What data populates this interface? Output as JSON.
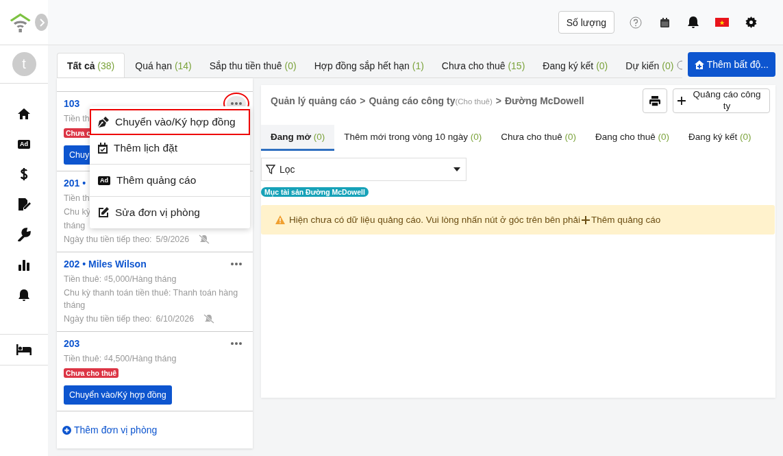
{
  "sidebar": {
    "avatar": "t",
    "items": [
      {
        "kind": "home"
      },
      {
        "kind": "ad",
        "text": "Ad"
      },
      {
        "kind": "dollar"
      },
      {
        "kind": "contract"
      },
      {
        "kind": "wrench"
      },
      {
        "kind": "chart"
      },
      {
        "kind": "bell"
      }
    ],
    "bottom_items": [
      {
        "kind": "bed"
      }
    ]
  },
  "topbar": {
    "quantity_button": "Số lượng",
    "icons": [
      {
        "kind": "help"
      },
      {
        "kind": "calendar"
      },
      {
        "kind": "bell"
      },
      {
        "kind": "flag"
      },
      {
        "kind": "settings"
      }
    ]
  },
  "tabs": [
    {
      "label": "Tất cả",
      "count": "(38)",
      "selected": true
    },
    {
      "label": "Quá hạn",
      "count": "(14)",
      "selected": false
    },
    {
      "label": "Sắp thu tiền thuê",
      "count": "(0)",
      "selected": false
    },
    {
      "label": "Hợp đồng sắp hết hạn",
      "count": "(1)",
      "selected": false
    },
    {
      "label": "Chưa cho thuê",
      "count": "(15)",
      "selected": false
    },
    {
      "label": "Đang ký kết",
      "count": "(0)",
      "selected": false
    },
    {
      "label": "Dự kiến",
      "count": "(0)",
      "selected": false
    }
  ],
  "add_property_button": "Thêm bất độ...",
  "units": [
    {
      "title": "103",
      "more": true,
      "more_highlighted": true,
      "lines": [
        "Tiền th"
      ],
      "badge": "Chưa c",
      "action": "Chuy"
    },
    {
      "title": "201 •",
      "lines": [
        "Tiền th",
        "Chu kỳ",
        "tháng"
      ],
      "next_label": "Ngày thu tiền tiếp theo:",
      "next_date": "5/9/2026"
    },
    {
      "title": "202 • Miles Wilson",
      "more": true,
      "lines": [
        "Tiền thuê: ₫5,000/Hàng tháng",
        "Chu kỳ thanh toán tiền thuê: Thanh toán hàng tháng"
      ],
      "next_label": "Ngày thu tiền tiếp theo:",
      "next_date": "6/10/2026"
    },
    {
      "title": "203",
      "more": true,
      "lines": [
        "Tiền thuê: ₫4,500/Hàng tháng"
      ],
      "badge": "Chưa cho thuê",
      "action": "Chuyển vào/Ký hợp đồng"
    }
  ],
  "add_unit": "Thêm đơn vị phòng",
  "menu": [
    {
      "kind": "pen",
      "label": "Chuyển vào/Ký hợp đồng",
      "selected": true
    },
    {
      "kind": "calendar",
      "label": "Thêm lịch đặt",
      "selected": false
    },
    {
      "kind": "ad",
      "label": "Thêm quảng cáo",
      "icon_text": "Ad",
      "selected": false
    },
    {
      "kind": "edit",
      "label": "Sửa đơn vị phòng",
      "selected": false
    }
  ],
  "panel": {
    "breadcrumb": [
      {
        "text": "Quản lý quảng cáo"
      },
      {
        "text": ">"
      },
      {
        "text": "Quảng cáo công ty",
        "note": "(Cho thuê)"
      },
      {
        "text": ">"
      },
      {
        "text": "Đường McDowell"
      }
    ],
    "add_ad_button": "Quảng cáo công ty",
    "tabs": [
      {
        "label": "Đang mở",
        "count": "(0)",
        "selected": true
      },
      {
        "label": "Thêm mới trong vòng 10 ngày",
        "count": "(0)",
        "selected": false
      },
      {
        "label": "Chưa cho thuê",
        "count": "(0)",
        "selected": false
      },
      {
        "label": "Đang cho thuê",
        "count": "(0)",
        "selected": false
      },
      {
        "label": "Đang ký kết",
        "count": "(0)",
        "selected": false
      }
    ],
    "filter": "Lọc",
    "tag": "Mục tài sản Đường McDowell",
    "alert": {
      "text": "Hiện chưa có dữ liệu quảng cáo. Vui lòng nhấn nút ở góc trên bên phải",
      "action": "Thêm quảng cáo"
    }
  }
}
